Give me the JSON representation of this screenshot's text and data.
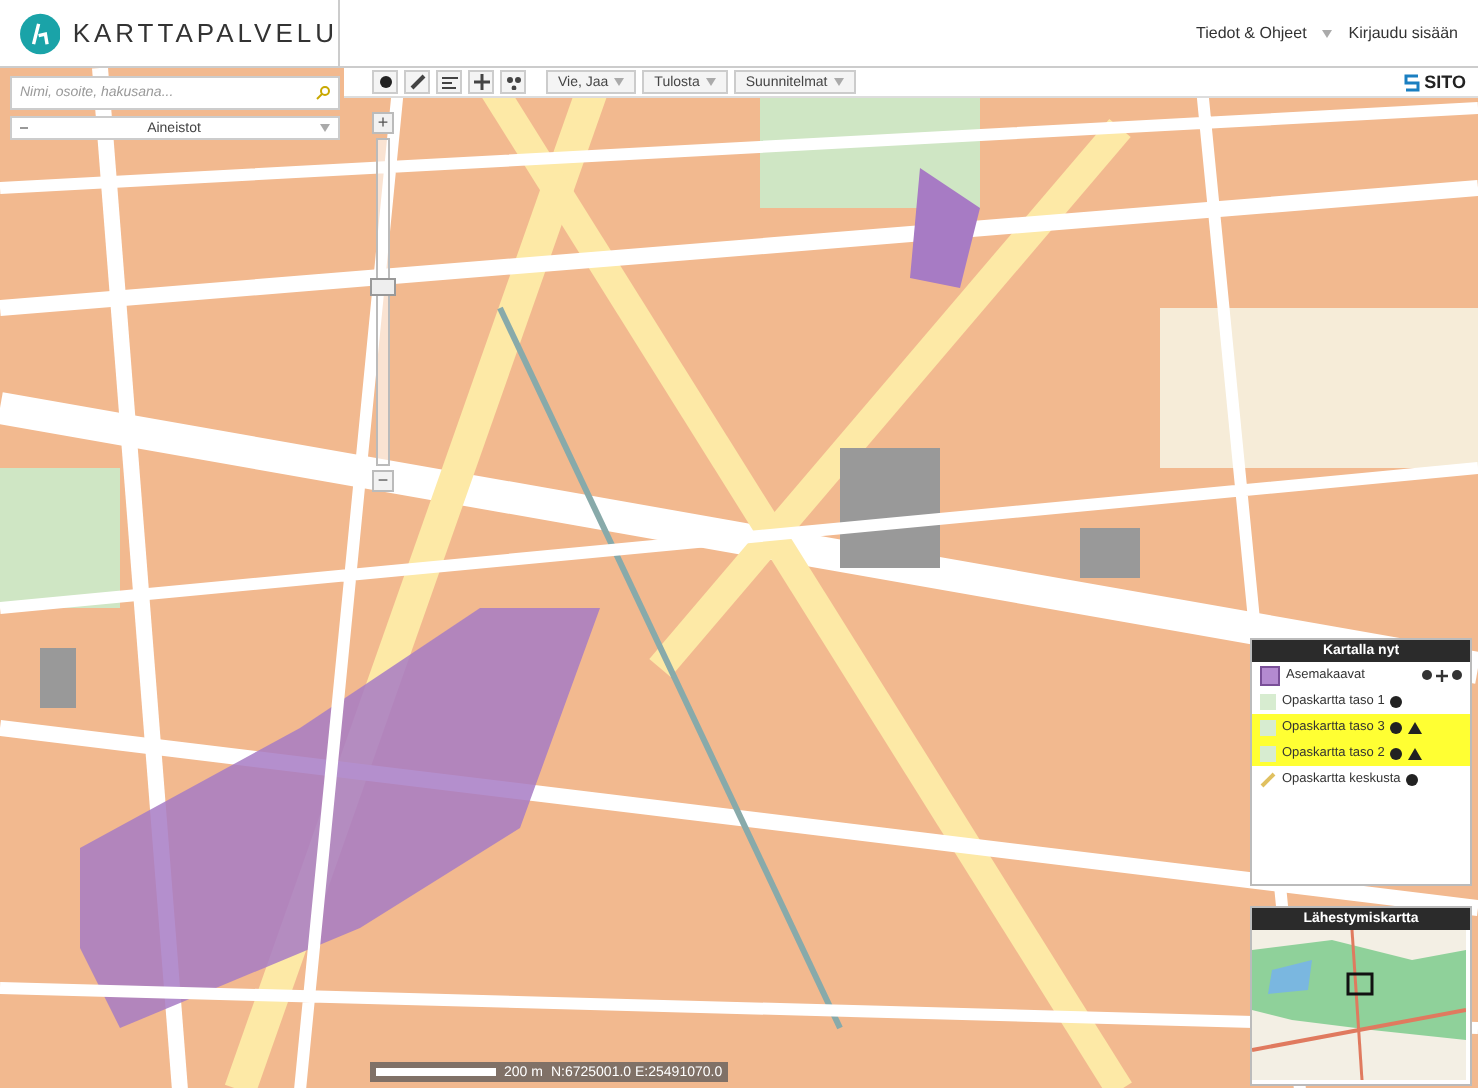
{
  "header": {
    "logo_text": "KARTTAPALVELU",
    "links": [
      {
        "label": "Tiedot & Ohjeet",
        "kind": "dropdown"
      },
      {
        "label": "Kirjaudu sisään",
        "kind": "link"
      }
    ]
  },
  "toolbar": {
    "tools": [
      {
        "kind": "point"
      },
      {
        "kind": "measure"
      },
      {
        "kind": "legend"
      },
      {
        "kind": "pan"
      },
      {
        "kind": "select"
      }
    ],
    "menus": [
      "Vie, Jaa",
      "Tulosta",
      "Suunnitelmat"
    ],
    "brand": "SITO"
  },
  "search": {
    "placeholder": "Nimi, osoite, hakusana..."
  },
  "datasets": {
    "label": "Aineistot"
  },
  "zoom": {
    "in": "+",
    "out": "−",
    "level": 0.55
  },
  "layers_panel": {
    "title": "Kartalla nyt",
    "layers": [
      {
        "name": "Asemakaavat",
        "kind": "plan",
        "color": "#b48ad0",
        "highlighted": false,
        "warning": false
      },
      {
        "name": "Opaskartta taso 1",
        "kind": "base",
        "color": "#d7ecd0",
        "highlighted": false,
        "warning": false
      },
      {
        "name": "Opaskartta taso 3",
        "kind": "base",
        "color": "#d7ecd0",
        "highlighted": true,
        "warning": true
      },
      {
        "name": "Opaskartta taso 2",
        "kind": "base",
        "color": "#d7ecd0",
        "highlighted": true,
        "warning": true
      },
      {
        "name": "Opaskartta keskusta",
        "kind": "route",
        "color": "#e0c060",
        "highlighted": false,
        "warning": false
      }
    ]
  },
  "overview_panel": {
    "title": "Lähestymiskartta"
  },
  "scale": {
    "label": "200 m",
    "coordinates": "N:6725001.0 E:25491070.0"
  }
}
